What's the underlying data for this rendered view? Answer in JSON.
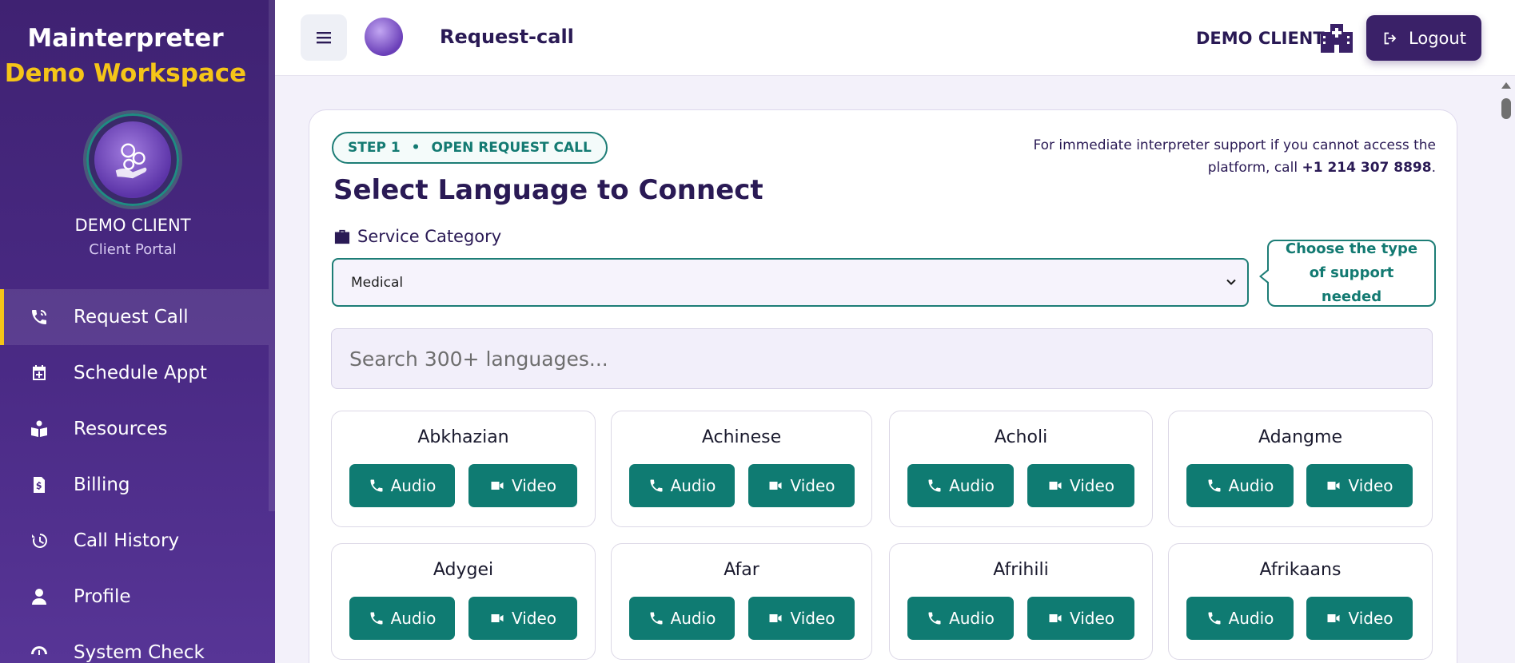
{
  "sidebar": {
    "app_name": "Mainterpreter",
    "workspace": "Demo Workspace",
    "client_name": "DEMO CLIENT",
    "client_subtitle": "Client Portal",
    "items": [
      {
        "label": "Request Call",
        "icon": "phone-call-icon",
        "active": true
      },
      {
        "label": "Schedule Appt",
        "icon": "calendar-plus-icon"
      },
      {
        "label": "Resources",
        "icon": "book-reader-icon"
      },
      {
        "label": "Billing",
        "icon": "invoice-dollar-icon"
      },
      {
        "label": "Call History",
        "icon": "history-icon"
      },
      {
        "label": "Profile",
        "icon": "user-icon"
      },
      {
        "label": "System Check",
        "icon": "gauge-icon"
      }
    ]
  },
  "header": {
    "page_title": "Request-call",
    "client_name": "DEMO CLIENT",
    "logout_label": "Logout"
  },
  "main": {
    "step_number": "STEP 1",
    "step_label": "OPEN REQUEST CALL",
    "heading": "Select Language to Connect",
    "support_text_prefix": "For immediate interpreter support if you cannot access the platform, call",
    "support_phone": "+1 214 307 8898",
    "support_text_suffix": ".",
    "service_category_label": "Service Category",
    "service_category_value": "Medical",
    "tooltip": "Choose the type of support needed",
    "search_placeholder": "Search 300+ languages...",
    "audio_label": "Audio",
    "video_label": "Video",
    "languages": [
      "Abkhazian",
      "Achinese",
      "Acholi",
      "Adangme",
      "Adygei",
      "Afar",
      "Afrihili",
      "Afrikaans"
    ]
  },
  "colors": {
    "sidebar_bg": "#3f2272",
    "accent_yellow": "#f5c518",
    "teal": "#0f7b72",
    "logout_bg": "#3a2168"
  }
}
